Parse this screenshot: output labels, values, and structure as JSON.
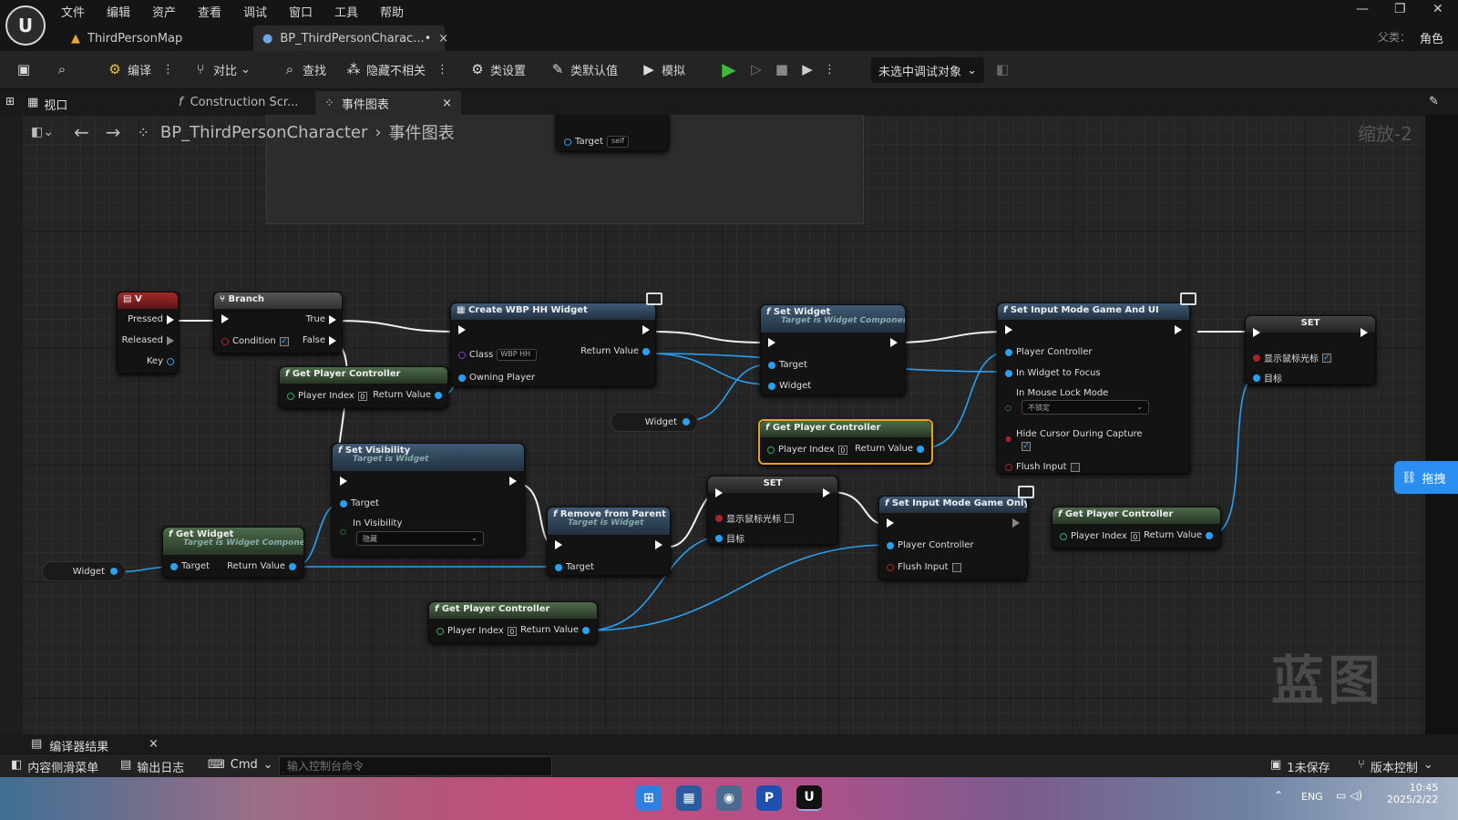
{
  "menu": [
    "文件",
    "编辑",
    "资产",
    "查看",
    "调试",
    "窗口",
    "工具",
    "帮助"
  ],
  "tabs": {
    "map": "ThirdPersonMap",
    "bp": "BP_ThirdPersonCharac...•"
  },
  "parent": {
    "label": "父类：",
    "value": "角色"
  },
  "toolbar": {
    "compile": "编译",
    "diff": "对比",
    "find": "查找",
    "hide": "隐藏不相关",
    "class_settings": "类设置",
    "class_defaults": "类默认值",
    "simulate": "模拟",
    "debug": "未选中调试对象"
  },
  "subtabs": {
    "viewport": "视口",
    "construction": "Construction Scr...",
    "event": "事件图表"
  },
  "breadcrumb": {
    "bp": "BP_ThirdPersonCharacter",
    "graph": "事件图表",
    "zoom": "缩放-2"
  },
  "nodes": {
    "target_self": {
      "label": "Target",
      "value": "self"
    },
    "v": {
      "title": "V",
      "pressed": "Pressed",
      "released": "Released",
      "key": "Key"
    },
    "branch": {
      "title": "Branch",
      "condition": "Condition",
      "t": "True",
      "f": "False"
    },
    "create": {
      "title": "Create WBP HH Widget",
      "class": "Class",
      "class_val": "WBP HH",
      "owning": "Owning Player",
      "ret": "Return Value"
    },
    "gpc1": {
      "title": "Get Player Controller",
      "idx": "Player Index",
      "idx_val": "0",
      "ret": "Return Value"
    },
    "setwidget": {
      "title": "Set Widget",
      "sub": "Target is Widget Component",
      "target": "Target",
      "widget": "Widget"
    },
    "widgetvar": "Widget",
    "gpc2": {
      "title": "Get Player Controller",
      "idx": "Player Index",
      "idx_val": "0",
      "ret": "Return Value"
    },
    "gameui": {
      "title": "Set Input Mode Game And UI",
      "pc": "Player Controller",
      "focus": "In Widget to Focus",
      "lock": "In Mouse Lock Mode",
      "lock_val": "不锁定",
      "hide": "Hide Cursor During Capture",
      "flush": "Flush Input"
    },
    "set1": {
      "title": "SET",
      "cursor": "显示鼠标光标",
      "target": "目标"
    },
    "setvis": {
      "title": "Set Visibility",
      "sub": "Target is Widget",
      "target": "Target",
      "vis": "In Visibility",
      "vis_val": "隐藏"
    },
    "remove": {
      "title": "Remove from Parent",
      "sub": "Target is Widget",
      "target": "Target"
    },
    "set2": {
      "title": "SET",
      "cursor": "显示鼠标光标",
      "target": "目标"
    },
    "gameonly": {
      "title": "Set Input Mode Game Only",
      "pc": "Player Controller",
      "flush": "Flush Input"
    },
    "gpc3": {
      "title": "Get Player Controller",
      "idx": "Player Index",
      "idx_val": "0",
      "ret": "Return Value"
    },
    "getwidget": {
      "title": "Get Widget",
      "sub": "Target is Widget Component",
      "target": "Target",
      "ret": "Return Value"
    },
    "widgetvar2": "Widget",
    "gpc4": {
      "title": "Get Player Controller",
      "idx": "Player Index",
      "idx_val": "0",
      "ret": "Return Value"
    }
  },
  "watermark": "蓝图",
  "side_button": "拖拽",
  "bottom": {
    "compiler": "编译器结果",
    "content": "内容侧滑菜单",
    "output": "输出日志",
    "cmd": "Cmd",
    "console_placeholder": "输入控制台命令",
    "unsaved": "1未保存",
    "version": "版本控制"
  },
  "tray": {
    "lang": "ENG",
    "time": "10:45",
    "date": "2025/2/22"
  }
}
